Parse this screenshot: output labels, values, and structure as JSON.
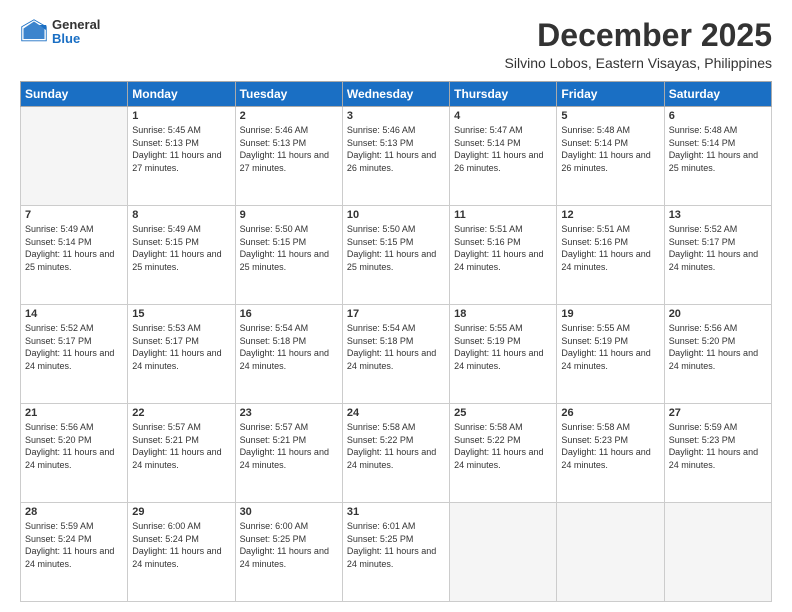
{
  "logo": {
    "general": "General",
    "blue": "Blue"
  },
  "header": {
    "month": "December 2025",
    "location": "Silvino Lobos, Eastern Visayas, Philippines"
  },
  "weekdays": [
    "Sunday",
    "Monday",
    "Tuesday",
    "Wednesday",
    "Thursday",
    "Friday",
    "Saturday"
  ],
  "weeks": [
    [
      {
        "day": "",
        "sunrise": "",
        "sunset": "",
        "daylight": ""
      },
      {
        "day": "1",
        "sunrise": "Sunrise: 5:45 AM",
        "sunset": "Sunset: 5:13 PM",
        "daylight": "Daylight: 11 hours and 27 minutes."
      },
      {
        "day": "2",
        "sunrise": "Sunrise: 5:46 AM",
        "sunset": "Sunset: 5:13 PM",
        "daylight": "Daylight: 11 hours and 27 minutes."
      },
      {
        "day": "3",
        "sunrise": "Sunrise: 5:46 AM",
        "sunset": "Sunset: 5:13 PM",
        "daylight": "Daylight: 11 hours and 26 minutes."
      },
      {
        "day": "4",
        "sunrise": "Sunrise: 5:47 AM",
        "sunset": "Sunset: 5:14 PM",
        "daylight": "Daylight: 11 hours and 26 minutes."
      },
      {
        "day": "5",
        "sunrise": "Sunrise: 5:48 AM",
        "sunset": "Sunset: 5:14 PM",
        "daylight": "Daylight: 11 hours and 26 minutes."
      },
      {
        "day": "6",
        "sunrise": "Sunrise: 5:48 AM",
        "sunset": "Sunset: 5:14 PM",
        "daylight": "Daylight: 11 hours and 25 minutes."
      }
    ],
    [
      {
        "day": "7",
        "sunrise": "Sunrise: 5:49 AM",
        "sunset": "Sunset: 5:14 PM",
        "daylight": "Daylight: 11 hours and 25 minutes."
      },
      {
        "day": "8",
        "sunrise": "Sunrise: 5:49 AM",
        "sunset": "Sunset: 5:15 PM",
        "daylight": "Daylight: 11 hours and 25 minutes."
      },
      {
        "day": "9",
        "sunrise": "Sunrise: 5:50 AM",
        "sunset": "Sunset: 5:15 PM",
        "daylight": "Daylight: 11 hours and 25 minutes."
      },
      {
        "day": "10",
        "sunrise": "Sunrise: 5:50 AM",
        "sunset": "Sunset: 5:15 PM",
        "daylight": "Daylight: 11 hours and 25 minutes."
      },
      {
        "day": "11",
        "sunrise": "Sunrise: 5:51 AM",
        "sunset": "Sunset: 5:16 PM",
        "daylight": "Daylight: 11 hours and 24 minutes."
      },
      {
        "day": "12",
        "sunrise": "Sunrise: 5:51 AM",
        "sunset": "Sunset: 5:16 PM",
        "daylight": "Daylight: 11 hours and 24 minutes."
      },
      {
        "day": "13",
        "sunrise": "Sunrise: 5:52 AM",
        "sunset": "Sunset: 5:17 PM",
        "daylight": "Daylight: 11 hours and 24 minutes."
      }
    ],
    [
      {
        "day": "14",
        "sunrise": "Sunrise: 5:52 AM",
        "sunset": "Sunset: 5:17 PM",
        "daylight": "Daylight: 11 hours and 24 minutes."
      },
      {
        "day": "15",
        "sunrise": "Sunrise: 5:53 AM",
        "sunset": "Sunset: 5:17 PM",
        "daylight": "Daylight: 11 hours and 24 minutes."
      },
      {
        "day": "16",
        "sunrise": "Sunrise: 5:54 AM",
        "sunset": "Sunset: 5:18 PM",
        "daylight": "Daylight: 11 hours and 24 minutes."
      },
      {
        "day": "17",
        "sunrise": "Sunrise: 5:54 AM",
        "sunset": "Sunset: 5:18 PM",
        "daylight": "Daylight: 11 hours and 24 minutes."
      },
      {
        "day": "18",
        "sunrise": "Sunrise: 5:55 AM",
        "sunset": "Sunset: 5:19 PM",
        "daylight": "Daylight: 11 hours and 24 minutes."
      },
      {
        "day": "19",
        "sunrise": "Sunrise: 5:55 AM",
        "sunset": "Sunset: 5:19 PM",
        "daylight": "Daylight: 11 hours and 24 minutes."
      },
      {
        "day": "20",
        "sunrise": "Sunrise: 5:56 AM",
        "sunset": "Sunset: 5:20 PM",
        "daylight": "Daylight: 11 hours and 24 minutes."
      }
    ],
    [
      {
        "day": "21",
        "sunrise": "Sunrise: 5:56 AM",
        "sunset": "Sunset: 5:20 PM",
        "daylight": "Daylight: 11 hours and 24 minutes."
      },
      {
        "day": "22",
        "sunrise": "Sunrise: 5:57 AM",
        "sunset": "Sunset: 5:21 PM",
        "daylight": "Daylight: 11 hours and 24 minutes."
      },
      {
        "day": "23",
        "sunrise": "Sunrise: 5:57 AM",
        "sunset": "Sunset: 5:21 PM",
        "daylight": "Daylight: 11 hours and 24 minutes."
      },
      {
        "day": "24",
        "sunrise": "Sunrise: 5:58 AM",
        "sunset": "Sunset: 5:22 PM",
        "daylight": "Daylight: 11 hours and 24 minutes."
      },
      {
        "day": "25",
        "sunrise": "Sunrise: 5:58 AM",
        "sunset": "Sunset: 5:22 PM",
        "daylight": "Daylight: 11 hours and 24 minutes."
      },
      {
        "day": "26",
        "sunrise": "Sunrise: 5:58 AM",
        "sunset": "Sunset: 5:23 PM",
        "daylight": "Daylight: 11 hours and 24 minutes."
      },
      {
        "day": "27",
        "sunrise": "Sunrise: 5:59 AM",
        "sunset": "Sunset: 5:23 PM",
        "daylight": "Daylight: 11 hours and 24 minutes."
      }
    ],
    [
      {
        "day": "28",
        "sunrise": "Sunrise: 5:59 AM",
        "sunset": "Sunset: 5:24 PM",
        "daylight": "Daylight: 11 hours and 24 minutes."
      },
      {
        "day": "29",
        "sunrise": "Sunrise: 6:00 AM",
        "sunset": "Sunset: 5:24 PM",
        "daylight": "Daylight: 11 hours and 24 minutes."
      },
      {
        "day": "30",
        "sunrise": "Sunrise: 6:00 AM",
        "sunset": "Sunset: 5:25 PM",
        "daylight": "Daylight: 11 hours and 24 minutes."
      },
      {
        "day": "31",
        "sunrise": "Sunrise: 6:01 AM",
        "sunset": "Sunset: 5:25 PM",
        "daylight": "Daylight: 11 hours and 24 minutes."
      },
      {
        "day": "",
        "sunrise": "",
        "sunset": "",
        "daylight": ""
      },
      {
        "day": "",
        "sunrise": "",
        "sunset": "",
        "daylight": ""
      },
      {
        "day": "",
        "sunrise": "",
        "sunset": "",
        "daylight": ""
      }
    ]
  ]
}
